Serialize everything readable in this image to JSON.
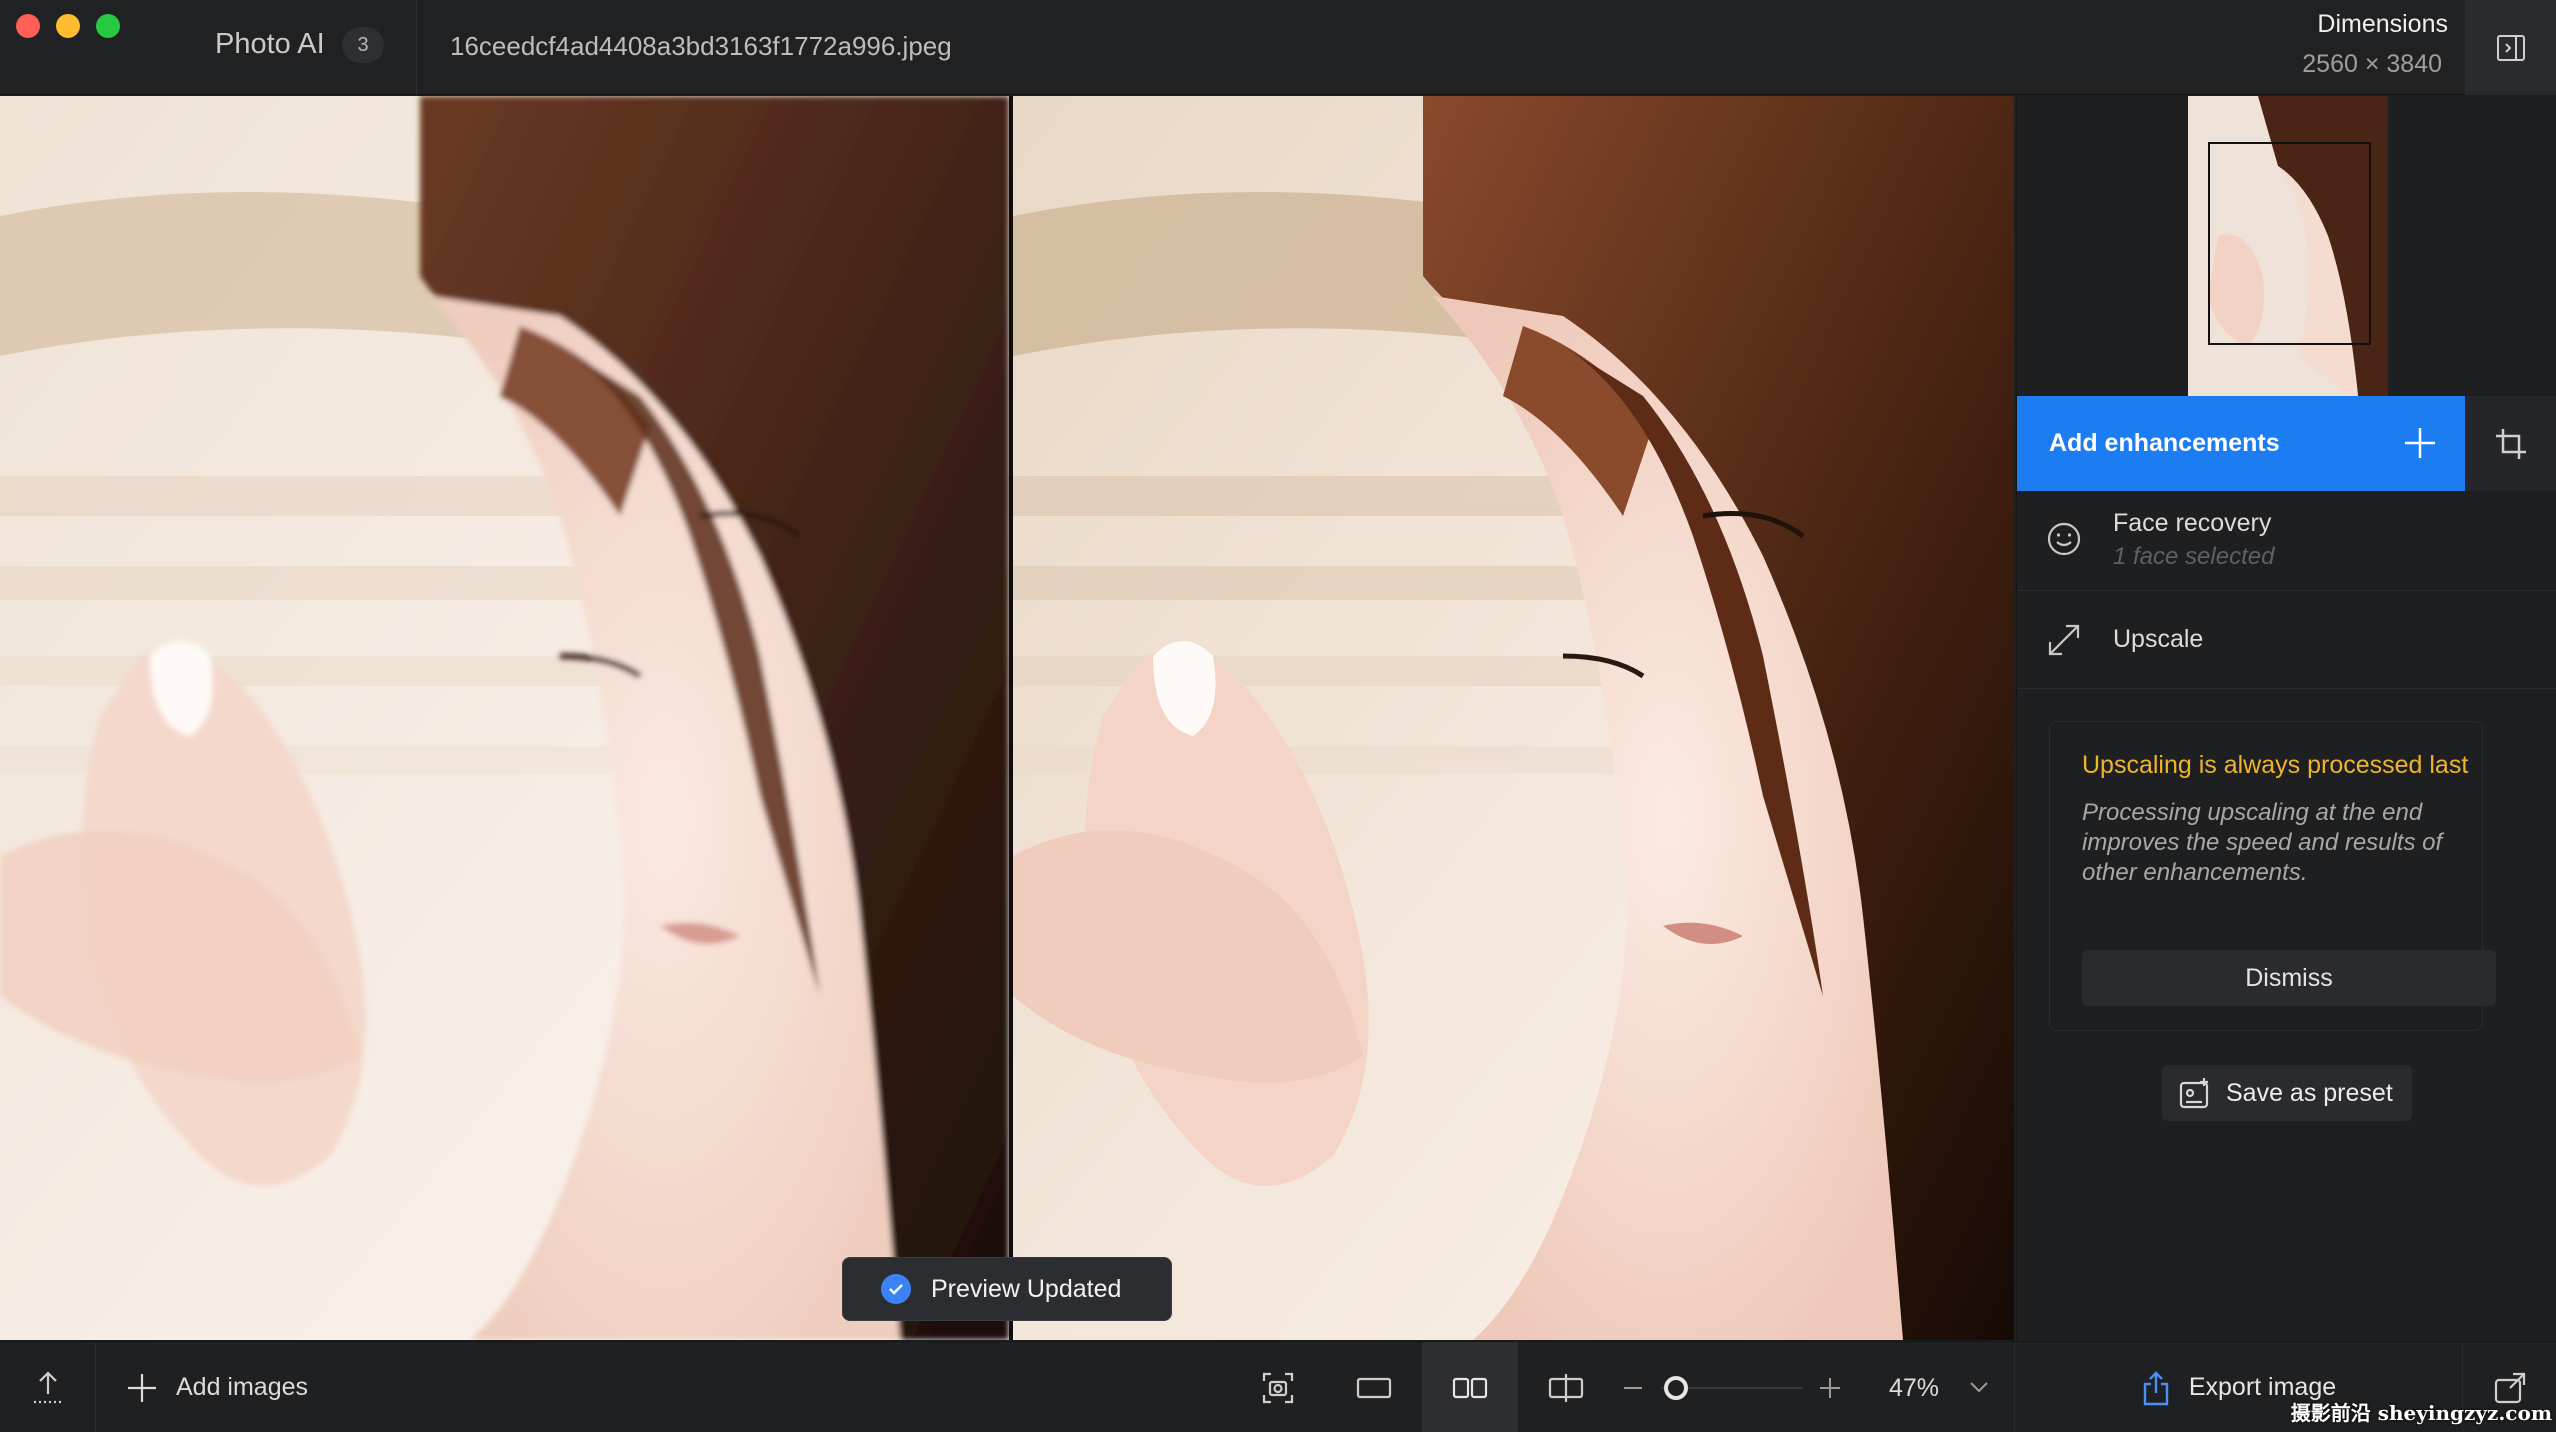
{
  "titlebar": {
    "app_name": "Photo AI",
    "badge_count": "3",
    "filename": "16ceedcf4ad4408a3bd3163f1772a996.jpeg",
    "dimensions_label": "Dimensions",
    "dimensions_value": "2560 × 3840"
  },
  "viewer": {
    "toast_text": "Preview Updated"
  },
  "sidebar": {
    "add_enhancements": "Add enhancements",
    "face_recovery": {
      "title": "Face recovery",
      "subtitle": "1 face selected"
    },
    "upscale": {
      "title": "Upscale"
    },
    "notice": {
      "title": "Upscaling is always processed last",
      "body": "Processing upscaling at the end improves the speed and results of other enhancements.",
      "dismiss": "Dismiss"
    },
    "save_preset": "Save as preset"
  },
  "bottombar": {
    "add_images": "Add images",
    "zoom": "47%",
    "zoom_level": 0.47,
    "export": "Export image"
  },
  "watermark": "摄影前沿 sheyingzyz.com",
  "colors": {
    "accent": "#1c7cf2",
    "notice_title": "#f0b429",
    "toast_check": "#3b82f6"
  }
}
